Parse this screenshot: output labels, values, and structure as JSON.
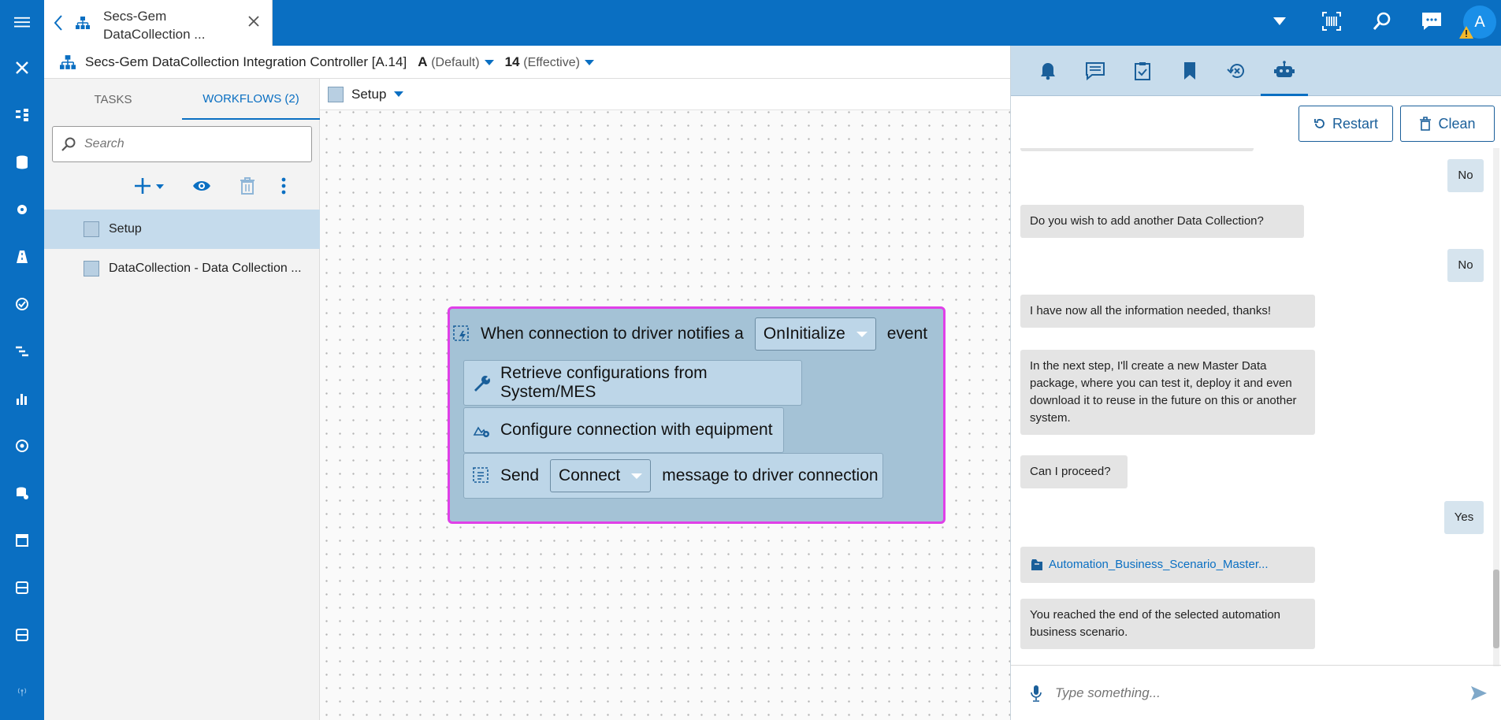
{
  "header": {
    "tab_title": "Secs-Gem DataCollection ...",
    "avatar_letter": "A",
    "accent_color": "#0a6fc2"
  },
  "subbar": {
    "controller_title": "Secs-Gem DataCollection Integration Controller [A.14]",
    "version_letter": "A",
    "version_default": "(Default)",
    "revision": "14",
    "revision_label": "(Effective)"
  },
  "left_panel": {
    "tabs": [
      "TASKS",
      "WORKFLOWS (2)"
    ],
    "search_placeholder": "Search",
    "workflows": [
      "Setup",
      "DataCollection - Data Collection ..."
    ]
  },
  "canvas": {
    "workflow_name": "Setup",
    "blocks": {
      "event_prefix": "When connection to driver notifies a",
      "event_value": "OnInitialize",
      "event_suffix": "event",
      "step1": "Retrieve configurations from System/MES",
      "step2": "Configure connection with equipment",
      "send_prefix": "Send",
      "send_value": "Connect",
      "send_suffix": "message to driver connection"
    }
  },
  "chat": {
    "restart_label": "Restart",
    "clean_label": "Clean",
    "messages": [
      {
        "role": "user",
        "text": "No"
      },
      {
        "role": "bot",
        "text": "Do you wish to add another Data Collection?"
      },
      {
        "role": "user",
        "text": "No"
      },
      {
        "role": "bot",
        "text": "I have now all the information needed, thanks!"
      },
      {
        "role": "bot",
        "text": "In the next step, I'll create a new Master Data package, where you can test it, deploy it and even download it to reuse in the future on this or another system."
      },
      {
        "role": "bot",
        "text": "Can I proceed?"
      },
      {
        "role": "user",
        "text": "Yes"
      },
      {
        "role": "bot",
        "text": "Automation_Business_Scenario_Master..."
      },
      {
        "role": "bot",
        "text": "You reached the end of the selected automation business scenario."
      }
    ],
    "input_placeholder": "Type something..."
  }
}
